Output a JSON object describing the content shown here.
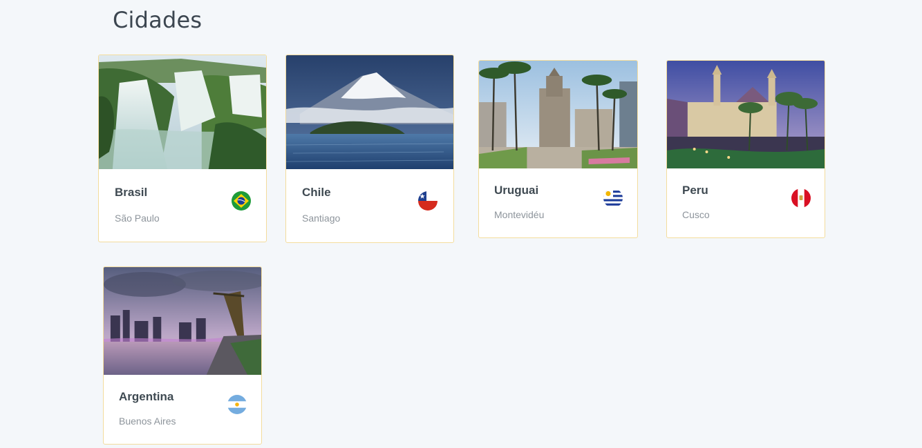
{
  "page": {
    "title": "Cidades"
  },
  "cards": [
    {
      "country": "Brasil",
      "city": "São Paulo",
      "flag_icon": "brazil-flag-icon",
      "photo": "waterfalls-photo"
    },
    {
      "country": "Chile",
      "city": "Santiago",
      "flag_icon": "chile-flag-icon",
      "photo": "volcano-lake-photo"
    },
    {
      "country": "Uruguai",
      "city": "Montevidéu",
      "flag_icon": "uruguay-flag-icon",
      "photo": "city-square-palms-photo"
    },
    {
      "country": "Peru",
      "city": "Cusco",
      "flag_icon": "peru-flag-icon",
      "photo": "cathedral-plaza-photo"
    },
    {
      "country": "Argentina",
      "city": "Buenos Aires",
      "flag_icon": "argentina-flag-icon",
      "photo": "harbor-dusk-photo"
    }
  ],
  "colors": {
    "background": "#f4f7fa",
    "card_border": "#f3dc9c",
    "title_text": "#3c4650",
    "country_text": "#3f4a52",
    "city_text": "#8d949b"
  }
}
